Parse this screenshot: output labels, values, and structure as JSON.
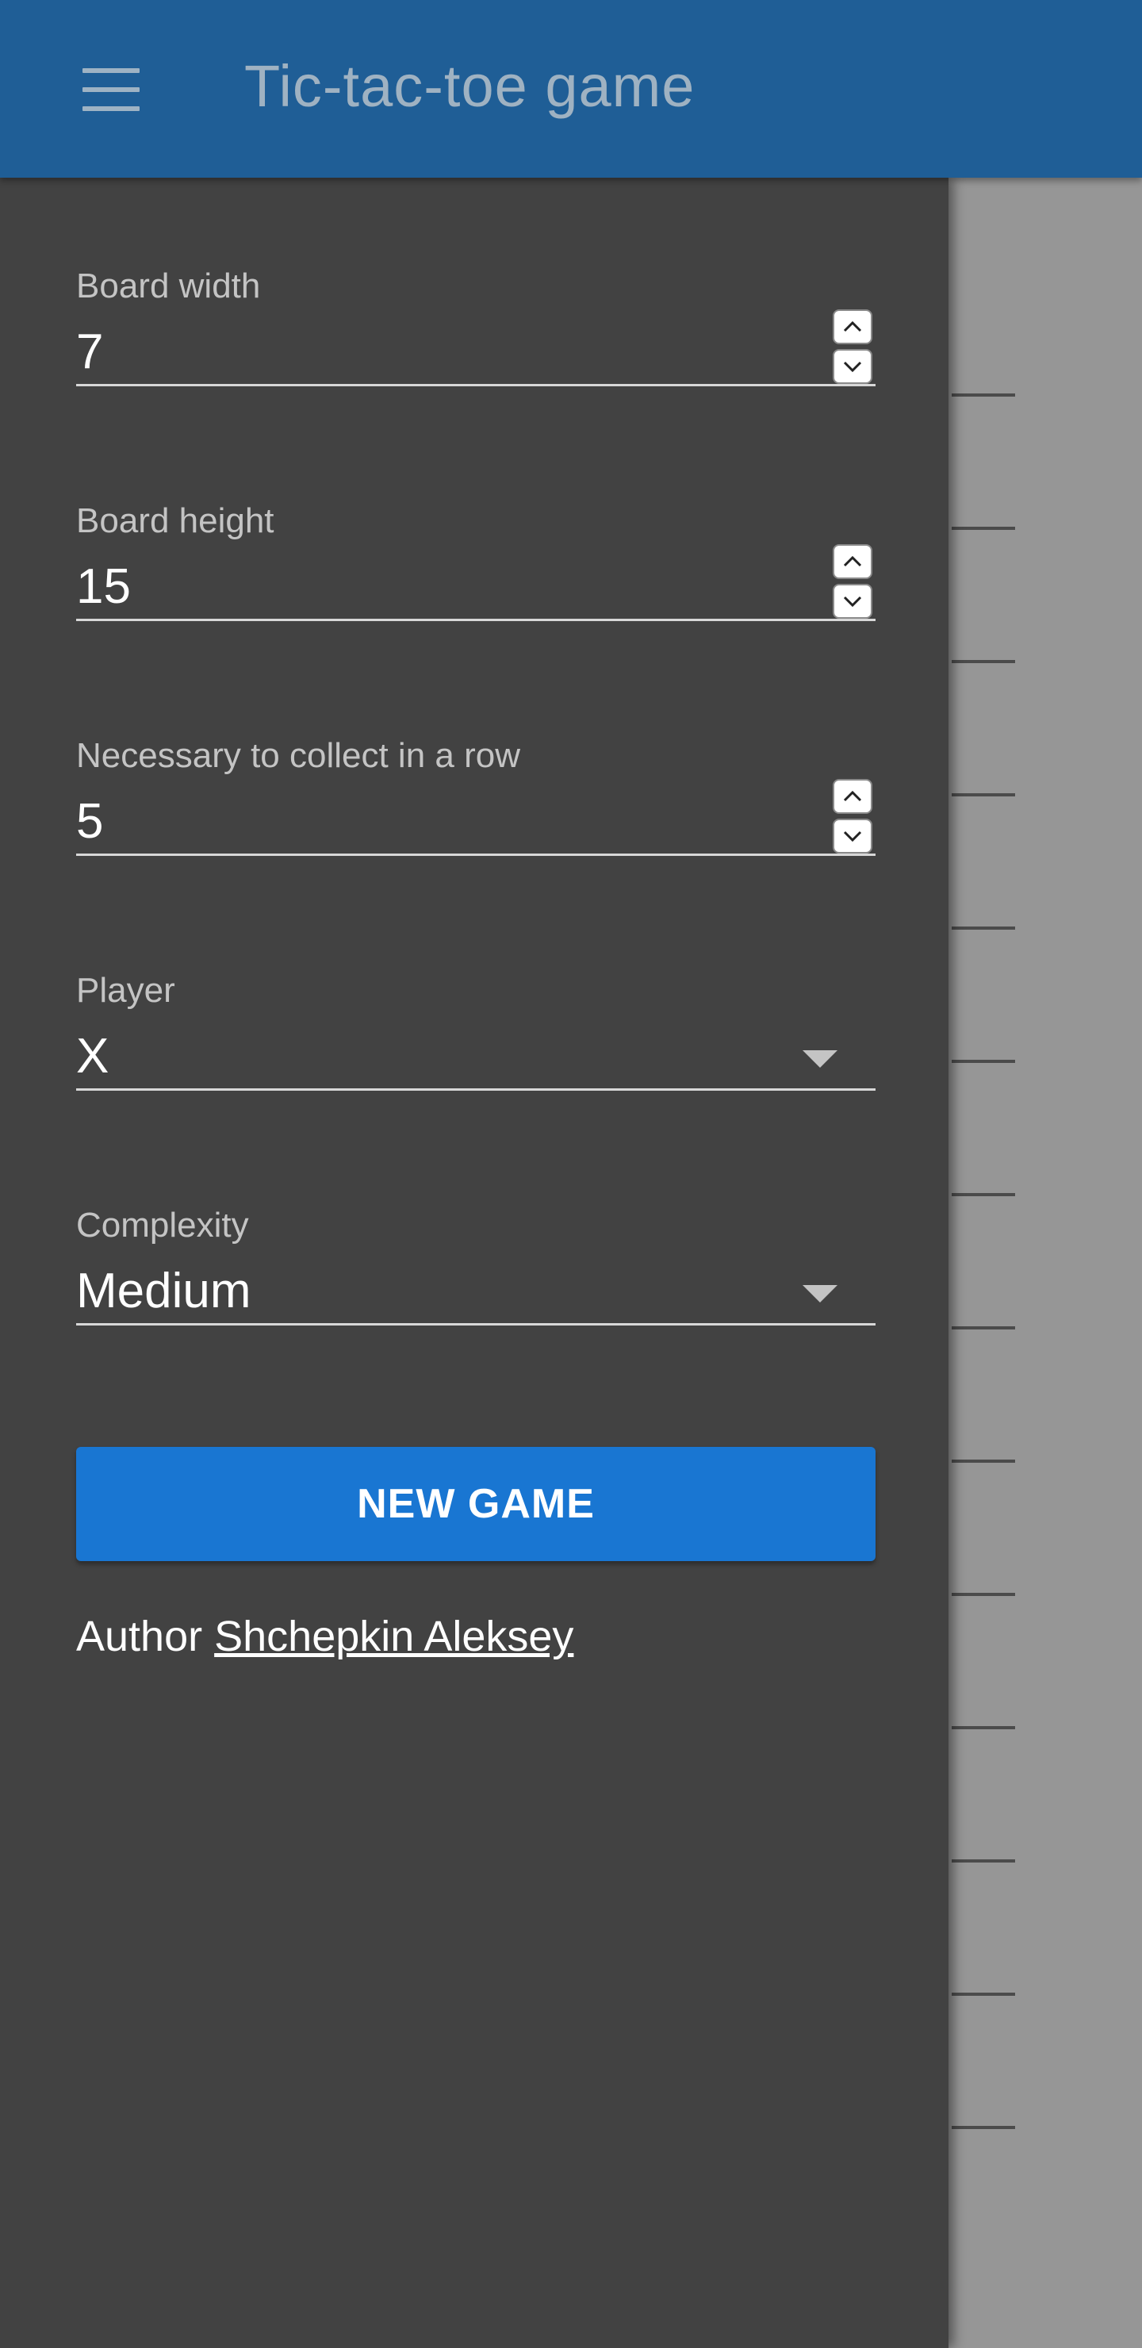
{
  "app_bar": {
    "title": "Tic-tac-toe game",
    "menu_icon": "hamburger-menu-icon",
    "color": "#1f5e96"
  },
  "drawer": {
    "background": "#424242",
    "fields": {
      "board_width": {
        "label": "Board width",
        "value": "7"
      },
      "board_height": {
        "label": "Board height",
        "value": "15"
      },
      "in_a_row": {
        "label": "Necessary to collect in a row",
        "value": "5"
      },
      "player": {
        "label": "Player",
        "value": "X"
      },
      "complexity": {
        "label": "Complexity",
        "value": "Medium"
      }
    },
    "new_game_button": {
      "label": "NEW GAME",
      "color": "#1976d2"
    },
    "author": {
      "prefix": "Author",
      "name": "Shchepkin Aleksey"
    }
  }
}
